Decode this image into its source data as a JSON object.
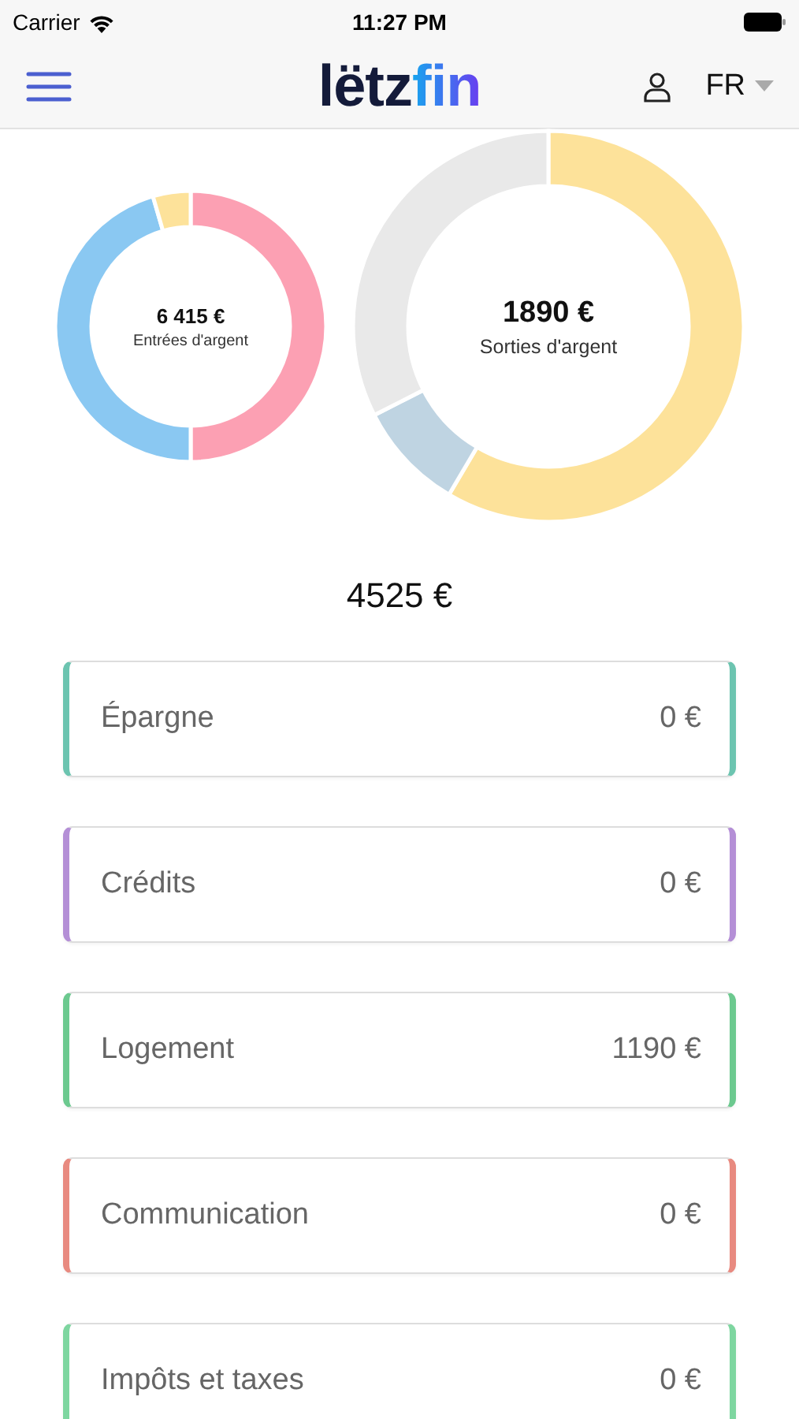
{
  "status_bar": {
    "carrier": "Carrier",
    "time": "11:27 PM"
  },
  "header": {
    "logo": [
      "lëtz",
      "fin"
    ],
    "language": "FR"
  },
  "charts": [
    {
      "amount": "6 415 €",
      "label": "Entrées d'argent",
      "kind": "small"
    },
    {
      "amount": "1890 €",
      "label": "Sorties d'argent",
      "kind": "large"
    }
  ],
  "balance": "4525 €",
  "categories": [
    {
      "name": "Épargne",
      "amount": "0 €",
      "color": "#6cc4b0"
    },
    {
      "name": "Crédits",
      "amount": "0 €",
      "color": "#b48fd6"
    },
    {
      "name": "Logement",
      "amount": "1190 €",
      "color": "#6cc98f"
    },
    {
      "name": "Communication",
      "amount": "0 €",
      "color": "#e88a80"
    },
    {
      "name": "Impôts et taxes",
      "amount": "0 €",
      "color": "#7ed6a0"
    }
  ]
}
